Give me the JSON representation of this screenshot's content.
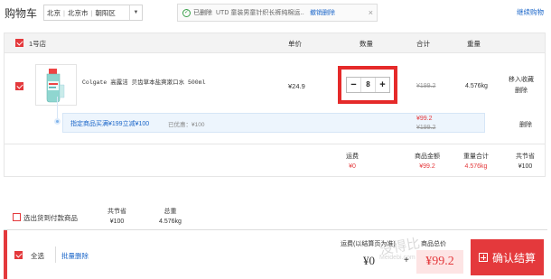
{
  "header": {
    "cart_title": "购物车",
    "region": {
      "province": "北京",
      "city": "北京市",
      "district": "朝阳区"
    },
    "notice": {
      "status": "已删除",
      "item": "UTD 童装男童针织长裤纯棉运...",
      "undo": "撤销删除"
    },
    "continue": "继续购物"
  },
  "shop": {
    "name": "1号店",
    "columns": {
      "price": "单价",
      "qty": "数量",
      "subtotal": "合计",
      "weight": "重量"
    }
  },
  "product": {
    "name": "Colgate 高露洁 贝齿草本盐爽漱口水 500ml",
    "price": "¥24.9",
    "qty": "8",
    "subtotal_strike": "¥199.2",
    "weight": "4.576kg",
    "move_fav": "移入收藏",
    "delete": "删除",
    "minus": "−",
    "plus": "+"
  },
  "promo": {
    "text": "指定商品买满¥199立减¥100",
    "saved": "已优惠：¥100",
    "total": "¥99.2",
    "total_strike": "¥199.2",
    "delete": "删除"
  },
  "summary": {
    "shipping_label": "运费",
    "shipping": "¥0",
    "amount_label": "商品金额",
    "amount": "¥99.2",
    "weight_label": "重量合计",
    "weight": "4.576kg",
    "save_label": "共节省",
    "save": "¥100"
  },
  "selected": {
    "label": "选出货到付款商品",
    "save_label": "共节省",
    "save": "¥100",
    "weight_label": "总重",
    "weight": "4.576kg"
  },
  "footer": {
    "select_all": "全选",
    "bulk_delete": "批量删除",
    "shipping_label": "运费(以结算页为准)",
    "shipping": "¥0",
    "total_label": "商品总价",
    "total": "¥99.2",
    "checkout": "确认结算"
  },
  "watermark": {
    "main": "没得比",
    "sub": "Meidebi.com"
  },
  "colors": {
    "accent": "#e4393c",
    "link": "#1b66c9",
    "highlight": "#e52a2a"
  }
}
